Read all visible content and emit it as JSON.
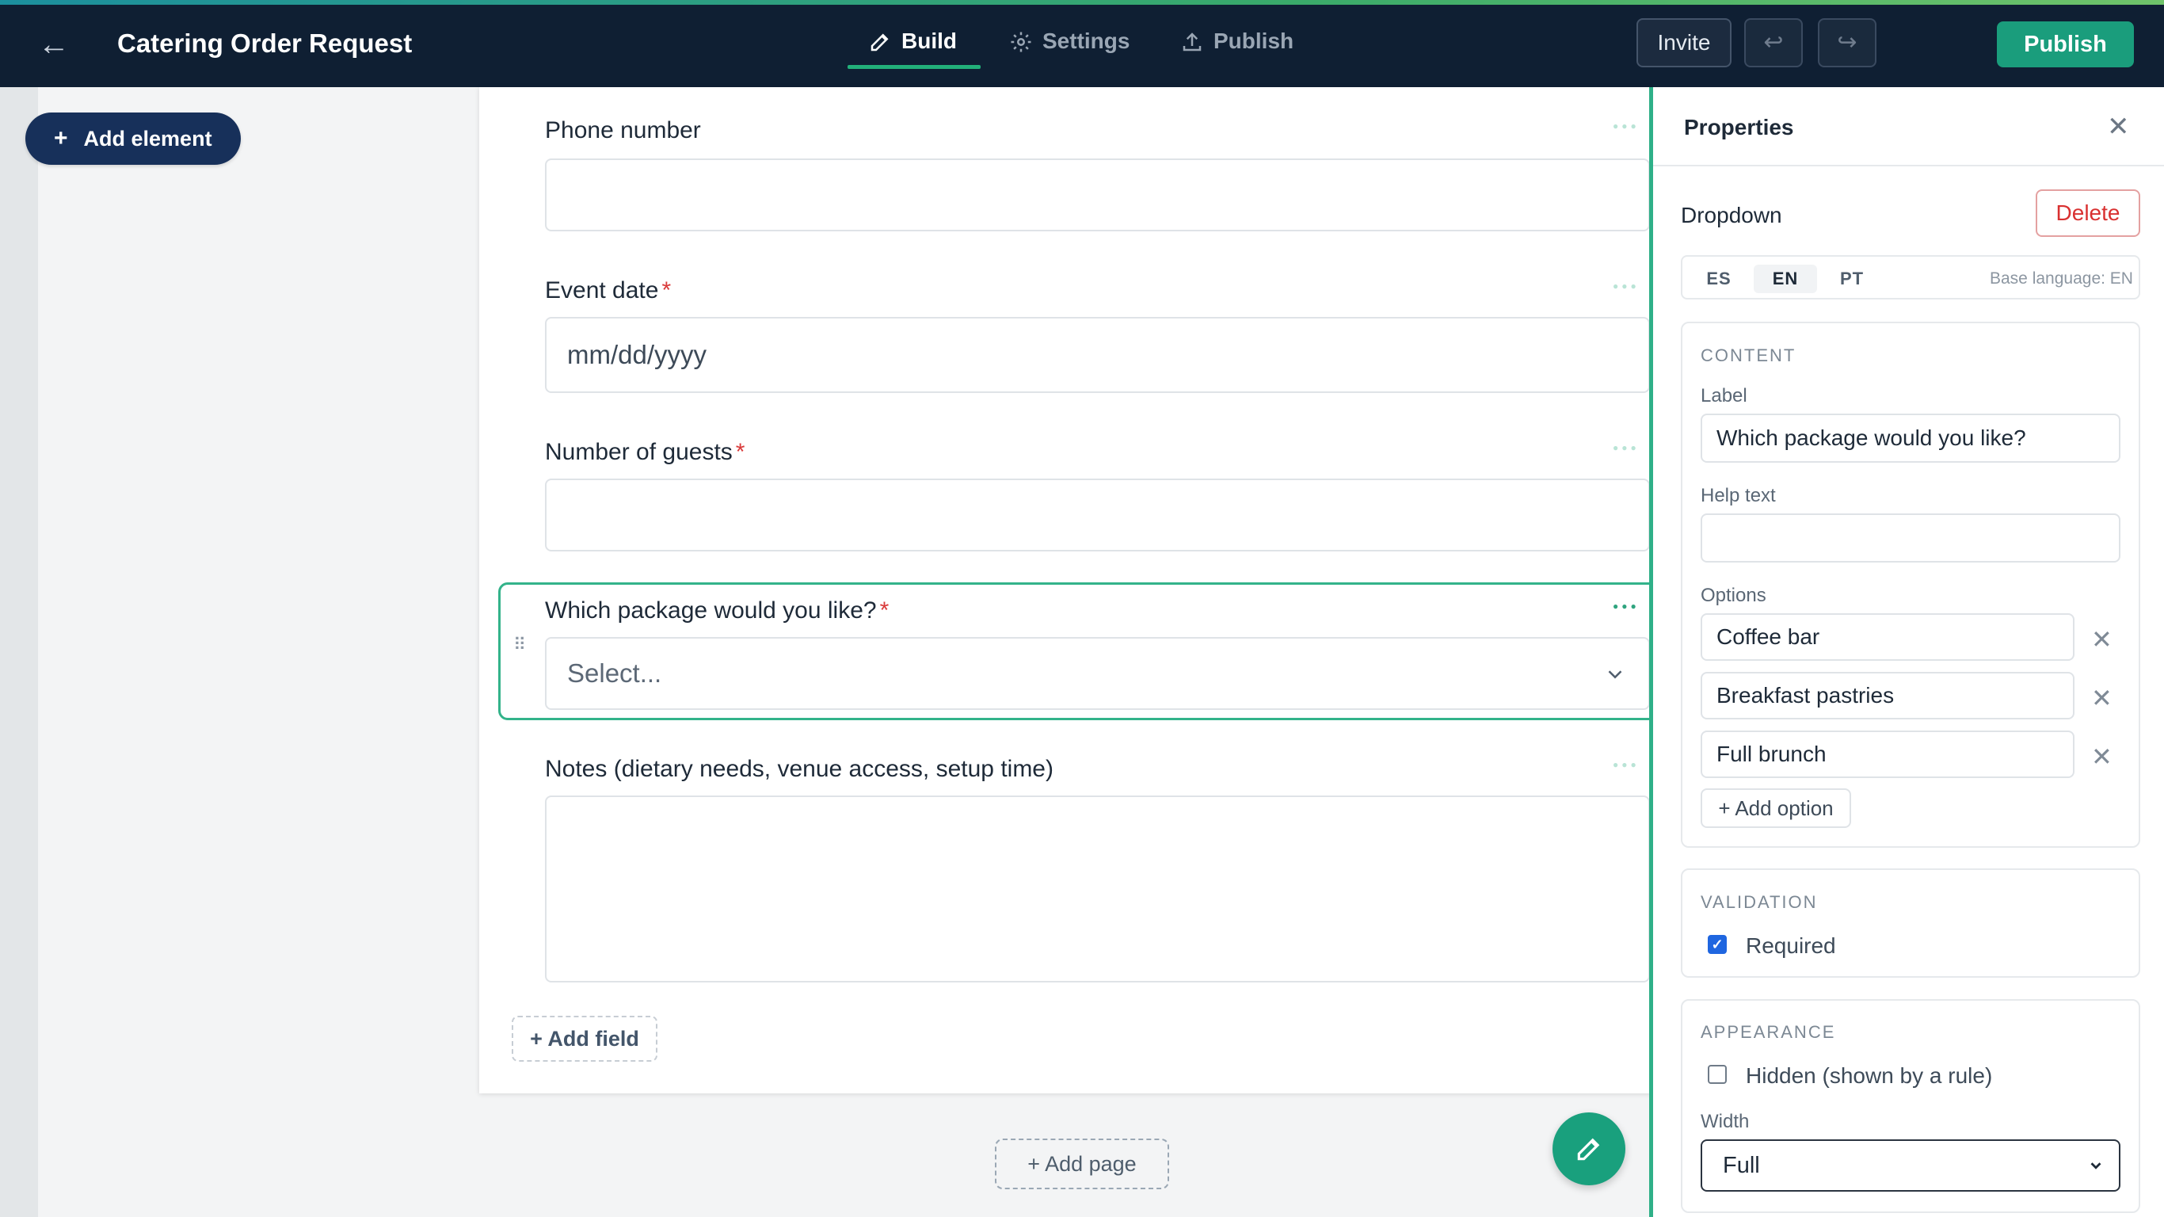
{
  "header": {
    "title": "Catering Order Request",
    "tabs": {
      "build": "Build",
      "settings": "Settings",
      "publish": "Publish"
    },
    "invite_label": "Invite",
    "publish_label": "Publish",
    "back_icon": "arrow-left-icon",
    "undo_icon": "undo-icon",
    "redo_icon": "redo-icon"
  },
  "sidebar": {
    "add_element_label": "Add element"
  },
  "form": {
    "fields": [
      {
        "label": "Phone number",
        "required": false,
        "placeholder": ""
      },
      {
        "label": "Event date",
        "required": true,
        "placeholder": "mm/dd/yyyy"
      },
      {
        "label": "Number of guests",
        "required": true,
        "placeholder": ""
      },
      {
        "label": "Which package would you like?",
        "required": true,
        "placeholder": "Select..."
      },
      {
        "label": "Notes (dietary needs, venue access, setup time)",
        "required": false,
        "placeholder": ""
      }
    ],
    "required_mark": "*",
    "add_field_label": "+ Add field",
    "add_page_label": "+ Add page"
  },
  "properties": {
    "title": "Properties",
    "element_type": "Dropdown",
    "delete_label": "Delete",
    "languages": [
      "ES",
      "EN",
      "PT"
    ],
    "active_language": "EN",
    "base_language": "Base language: EN",
    "content": {
      "heading": "CONTENT",
      "label_caption": "Label",
      "label_value": "Which package would you like?",
      "help_caption": "Help text",
      "help_value": "",
      "options_caption": "Options",
      "options": [
        "Coffee bar",
        "Breakfast pastries",
        "Full brunch"
      ],
      "add_option_label": "+ Add option"
    },
    "validation": {
      "heading": "VALIDATION",
      "required_label": "Required",
      "required_checked": true
    },
    "appearance": {
      "heading": "APPEARANCE",
      "hidden_label": "Hidden (shown by a rule)",
      "hidden_checked": false,
      "width_caption": "Width",
      "width_value": "Full"
    }
  },
  "colors": {
    "topbar": "#0f1f33",
    "accent": "#1a9d7c",
    "selection": "#33b38a",
    "required": "#d93a3a",
    "delete": "#d93131"
  }
}
